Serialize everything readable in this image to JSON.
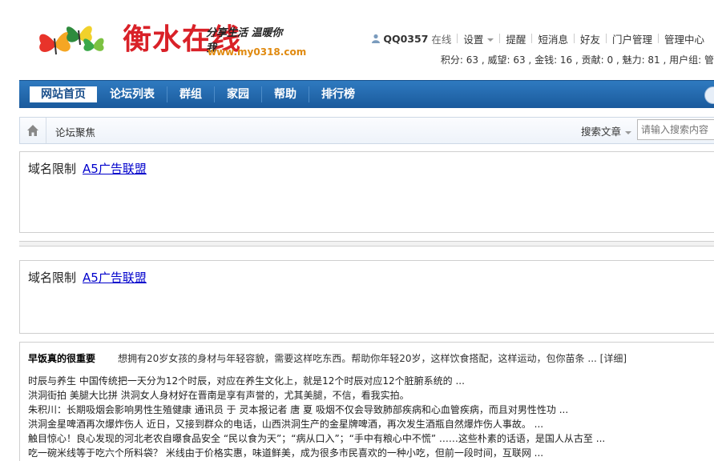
{
  "header": {
    "site_name": "衡水在线",
    "slogan": "分享生活 温暖你我",
    "site_url": "www.my0318.com"
  },
  "user": {
    "username": "QQ0357",
    "status": "在线",
    "links": [
      "设置",
      "提醒",
      "短消息",
      "好友",
      "门户管理",
      "管理中心"
    ],
    "stats": "积分: 63 , 威望: 63 , 金钱: 16 , 贡献: 0 , 魅力: 81 , 用户组: 管"
  },
  "nav": {
    "items": [
      "网站首页",
      "论坛列表",
      "群组",
      "家园",
      "帮助",
      "排行榜"
    ]
  },
  "breadcrumb": {
    "current": "论坛聚焦",
    "search_type": "搜索文章",
    "search_placeholder": "请输入搜索内容"
  },
  "ads": [
    {
      "label": "域名限制",
      "link": "A5广告联盟"
    },
    {
      "label": "域名限制",
      "link": "A5广告联盟"
    }
  ],
  "news": {
    "headline_title": "早饭真的很重要",
    "headline_desc": "想拥有20岁女孩的身材与年轻容貌，需要这样吃东西。帮助你年轻20岁，这样饮食搭配，这样运动，包你苗条 ... [详细]",
    "items": [
      "时辰与养生       中国传统把一天分为12个时辰，对应在养生文化上，就是12个时辰对应12个脏腑系统的 ...",
      "洪洞街拍 美腿大比拼 洪洞女人身材好在晋南是享有声誉的，尤其美腿，不信，看我实拍。",
      "朱积川：长期吸烟会影响男性生殖健康 通讯员 于 灵本报记者 唐 夏        吸烟不仅会导致肺部疾病和心血管疾病，而且对男性性功 ...",
      "洪洞金星啤酒再次爆炸伤人 近日，又接到群众的电话，山西洪洞生产的金星牌啤酒，再次发生酒瓶自然爆炸伤人事故。 ...",
      "触目惊心！良心发现的河北老农自曝食品安全 “民以食为天”；“病从口入”；“手中有粮心中不慌” ……这些朴素的话语，是国人从古至 ...",
      "吃一碗米线等于吃六个所料袋？ 米线由于价格实惠，味道鲜美，成为很多市民喜欢的一种小吃，但前一段时间，互联网 ..."
    ]
  },
  "colors": {
    "nav_bg": "#2169ae",
    "link_blue": "#0000cc",
    "logo_red": "#d92128",
    "url_orange": "#e08a10"
  }
}
